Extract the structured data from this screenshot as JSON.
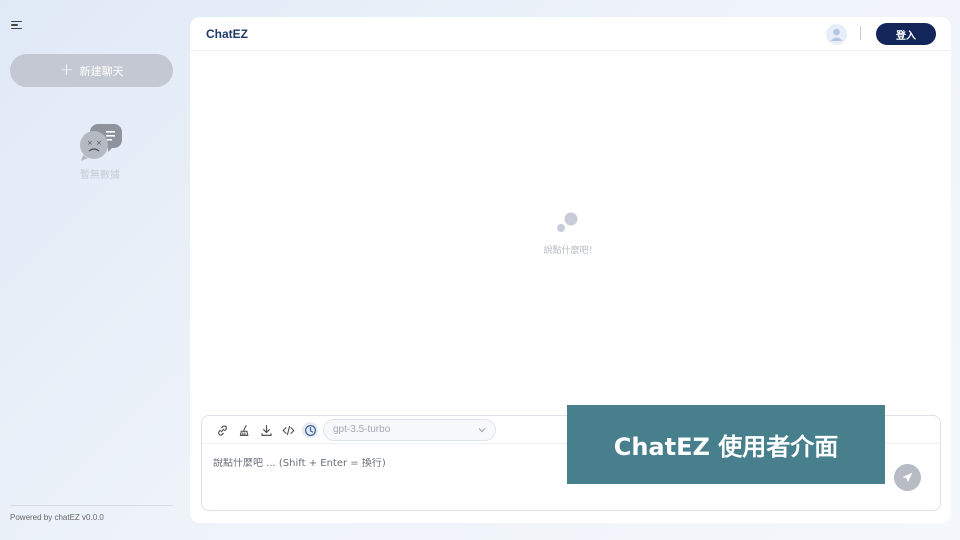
{
  "sidebar": {
    "new_chat_label": "新建聊天",
    "empty_label": "暫無數據",
    "powered_by": "Powered by chatEZ v0.0.0"
  },
  "header": {
    "brand": "ChatEZ",
    "login_label": "登入"
  },
  "main": {
    "empty_prompt": "說點什麼吧！"
  },
  "composer": {
    "model": "gpt-3.5-turbo",
    "placeholder": "說點什麼吧 ... (Shift + Enter = 換行)",
    "tools": [
      "link-icon",
      "clear-icon",
      "download-icon",
      "code-icon",
      "history-icon"
    ]
  },
  "banner": {
    "title": "ChatEZ 使用者介面"
  },
  "colors": {
    "brand_navy": "#13265a",
    "banner_teal": "#477f8c",
    "new_chat_gray": "#c3c8d2"
  }
}
